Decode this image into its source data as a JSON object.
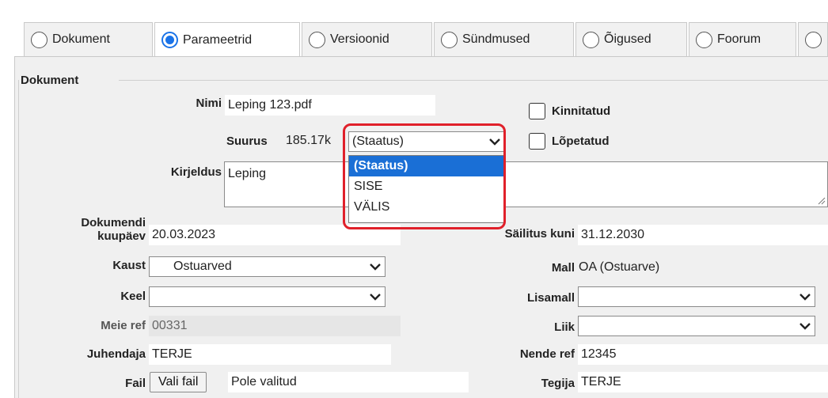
{
  "tabs": [
    {
      "label": "Dokument",
      "active": false
    },
    {
      "label": "Parameetrid",
      "active": true
    },
    {
      "label": "Versioonid",
      "active": false
    },
    {
      "label": "Sündmused",
      "active": false
    },
    {
      "label": "Õigused",
      "active": false
    },
    {
      "label": "Foorum",
      "active": false
    }
  ],
  "section": {
    "legend": "Dokument"
  },
  "fields": {
    "nimi": {
      "label": "Nimi",
      "value": "Leping 123.pdf"
    },
    "suurus": {
      "label": "Suurus",
      "value": "185.17k"
    },
    "staatus": {
      "value": "(Staatus)",
      "options": [
        "(Staatus)",
        "SISE",
        "VÄLIS"
      ]
    },
    "kinnitatud": {
      "label": "Kinnitatud"
    },
    "lopetatud": {
      "label": "Lõpetatud"
    },
    "kirjeldus": {
      "label": "Kirjeldus",
      "value": "Leping"
    },
    "kuupaev": {
      "label_line1": "Dokumendi",
      "label_line2": "kuupäev",
      "value": "20.03.2023"
    },
    "sailitus": {
      "label": "Säilitus kuni",
      "value": "31.12.2030"
    },
    "kaust": {
      "label": "Kaust",
      "value": "Ostuarved"
    },
    "mall": {
      "label": "Mall",
      "value": "OA (Ostuarve)"
    },
    "keel": {
      "label": "Keel",
      "value": ""
    },
    "lisamall": {
      "label": "Lisamall",
      "value": ""
    },
    "meie_ref": {
      "label": "Meie ref",
      "value": "00331"
    },
    "liik": {
      "label": "Liik",
      "value": ""
    },
    "juhendaja": {
      "label": "Juhendaja",
      "value": "TERJE"
    },
    "nende_ref": {
      "label": "Nende ref",
      "value": "12345"
    },
    "fail": {
      "label": "Fail",
      "button": "Vali fail",
      "status": "Pole valitud"
    },
    "tegija": {
      "label": "Tegija",
      "value": "TERJE"
    }
  },
  "colors": {
    "accent": "#1a73e8",
    "highlight": "#e0202a",
    "selected_option": "#1a6fd6"
  }
}
